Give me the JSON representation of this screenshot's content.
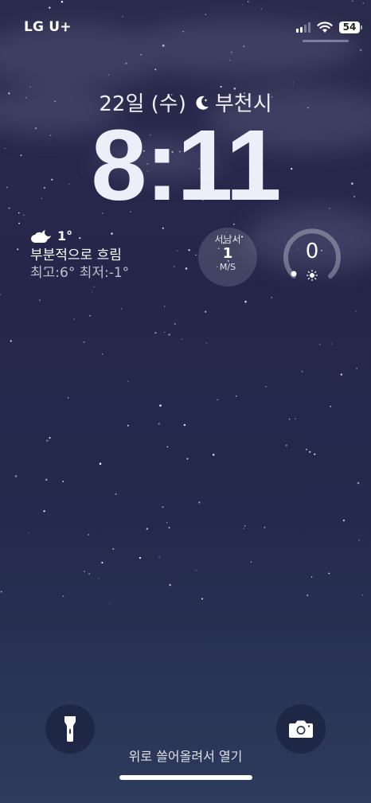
{
  "status_bar": {
    "carrier": "LG U+",
    "battery": "54",
    "signal_bars_on": 2,
    "signal_bars_total": 4
  },
  "lock": {
    "date": "22일 (수)",
    "city": "부천시",
    "time": "8:11"
  },
  "weather": {
    "temperature": "1°",
    "condition": "부분적으로 흐림",
    "hilo": "최고:6° 최저:-1°",
    "icon": "partly-cloudy-night-icon"
  },
  "wind": {
    "direction": "서남서",
    "speed": "1",
    "unit": "M/S"
  },
  "uv": {
    "value": "0",
    "level": 0
  },
  "bottom": {
    "swipe_hint": "위로 쓸어올려서 열기",
    "flashlight_icon": "flashlight-icon",
    "camera_icon": "camera-icon"
  },
  "colors": {
    "background_top": "#2a2a4c",
    "background_bottom": "#2e3b5c"
  }
}
